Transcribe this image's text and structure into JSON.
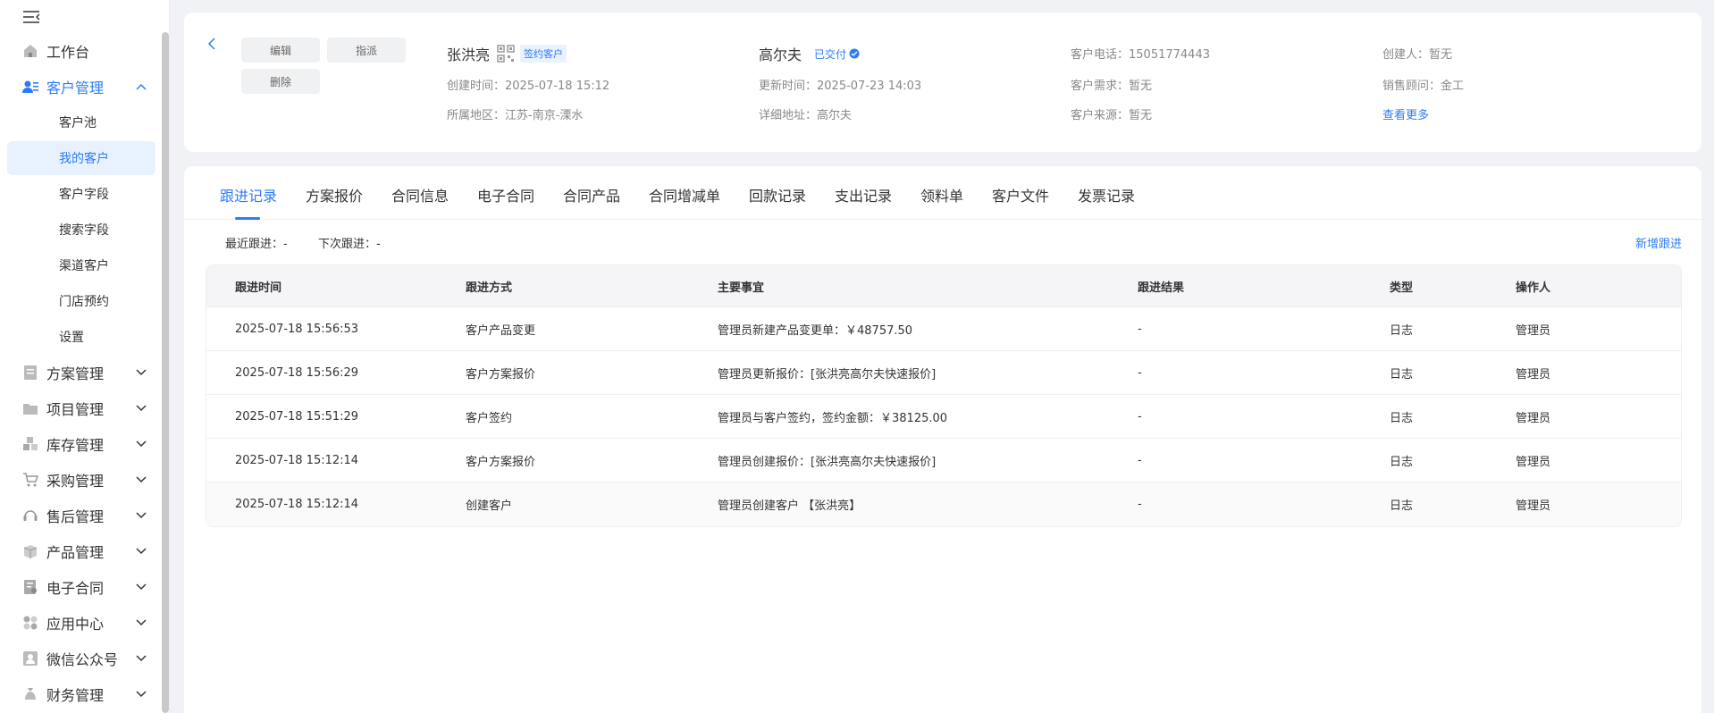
{
  "sidebar": {
    "items": [
      {
        "label": "工作台",
        "icon": "home-icon"
      },
      {
        "label": "客户管理",
        "icon": "users-icon",
        "expanded": true
      },
      {
        "label": "方案管理",
        "icon": "document-icon"
      },
      {
        "label": "项目管理",
        "icon": "folder-icon"
      },
      {
        "label": "库存管理",
        "icon": "boxes-icon"
      },
      {
        "label": "采购管理",
        "icon": "cart-icon"
      },
      {
        "label": "售后管理",
        "icon": "headset-icon"
      },
      {
        "label": "产品管理",
        "icon": "package-icon"
      },
      {
        "label": "电子合同",
        "icon": "contract-icon"
      },
      {
        "label": "应用中心",
        "icon": "apps-icon"
      },
      {
        "label": "微信公众号",
        "icon": "wechat-icon"
      },
      {
        "label": "财务管理",
        "icon": "money-bag-icon"
      }
    ],
    "sub_items": [
      "客户池",
      "我的客户",
      "客户字段",
      "搜索字段",
      "渠道客户",
      "门店预约",
      "设置"
    ]
  },
  "header": {
    "buttons": {
      "edit": "编辑",
      "assign": "指派",
      "delete": "删除"
    },
    "customer_name": "张洪亮",
    "customer_tag": "签约客户",
    "created_label": "创建时间：",
    "created_value": "2025-07-18 15:12",
    "region_label": "所属地区：",
    "region_value": "江苏-南京-溧水",
    "project_name": "高尔夫",
    "project_status": "已交付",
    "updated_label": "更新时间：",
    "updated_value": "2025-07-23 14:03",
    "address_label": "详细地址：",
    "address_value": "高尔夫",
    "phone_label": "客户电话：",
    "phone_value": "15051774443",
    "need_label": "客户需求：",
    "need_value": "暂无",
    "source_label": "客户来源：",
    "source_value": "暂无",
    "creator_label": "创建人：",
    "creator_value": "暂无",
    "sales_label": "销售顾问：",
    "sales_value": "金工",
    "more_link": "查看更多"
  },
  "tabs": [
    "跟进记录",
    "方案报价",
    "合同信息",
    "电子合同",
    "合同产品",
    "合同增减单",
    "回款记录",
    "支出记录",
    "领料单",
    "客户文件",
    "发票记录"
  ],
  "follow": {
    "recent_label": "最近跟进：",
    "recent_value": "-",
    "next_label": "下次跟进：",
    "next_value": "-",
    "add_button": "新增跟进"
  },
  "table": {
    "headers": [
      "跟进时间",
      "跟进方式",
      "主要事宜",
      "跟进结果",
      "类型",
      "操作人"
    ],
    "rows": [
      [
        "2025-07-18 15:56:53",
        "客户产品变更",
        "管理员新建产品变更单：￥48757.50",
        "-",
        "日志",
        "管理员"
      ],
      [
        "2025-07-18 15:56:29",
        "客户方案报价",
        "管理员更新报价：[张洪亮高尔夫快速报价]",
        "-",
        "日志",
        "管理员"
      ],
      [
        "2025-07-18 15:51:29",
        "客户签约",
        "管理员与客户签约，签约金额：￥38125.00",
        "-",
        "日志",
        "管理员"
      ],
      [
        "2025-07-18 15:12:14",
        "客户方案报价",
        "管理员创建报价：[张洪亮高尔夫快速报价]",
        "-",
        "日志",
        "管理员"
      ],
      [
        "2025-07-18 15:12:14",
        "创建客户",
        "管理员创建客户 【张洪亮】",
        "-",
        "日志",
        "管理员"
      ]
    ]
  },
  "colors": {
    "accent": "#2d7cf6",
    "sidebar_active_bg": "#e8f1fe",
    "page_bg": "#f0f2f5"
  }
}
